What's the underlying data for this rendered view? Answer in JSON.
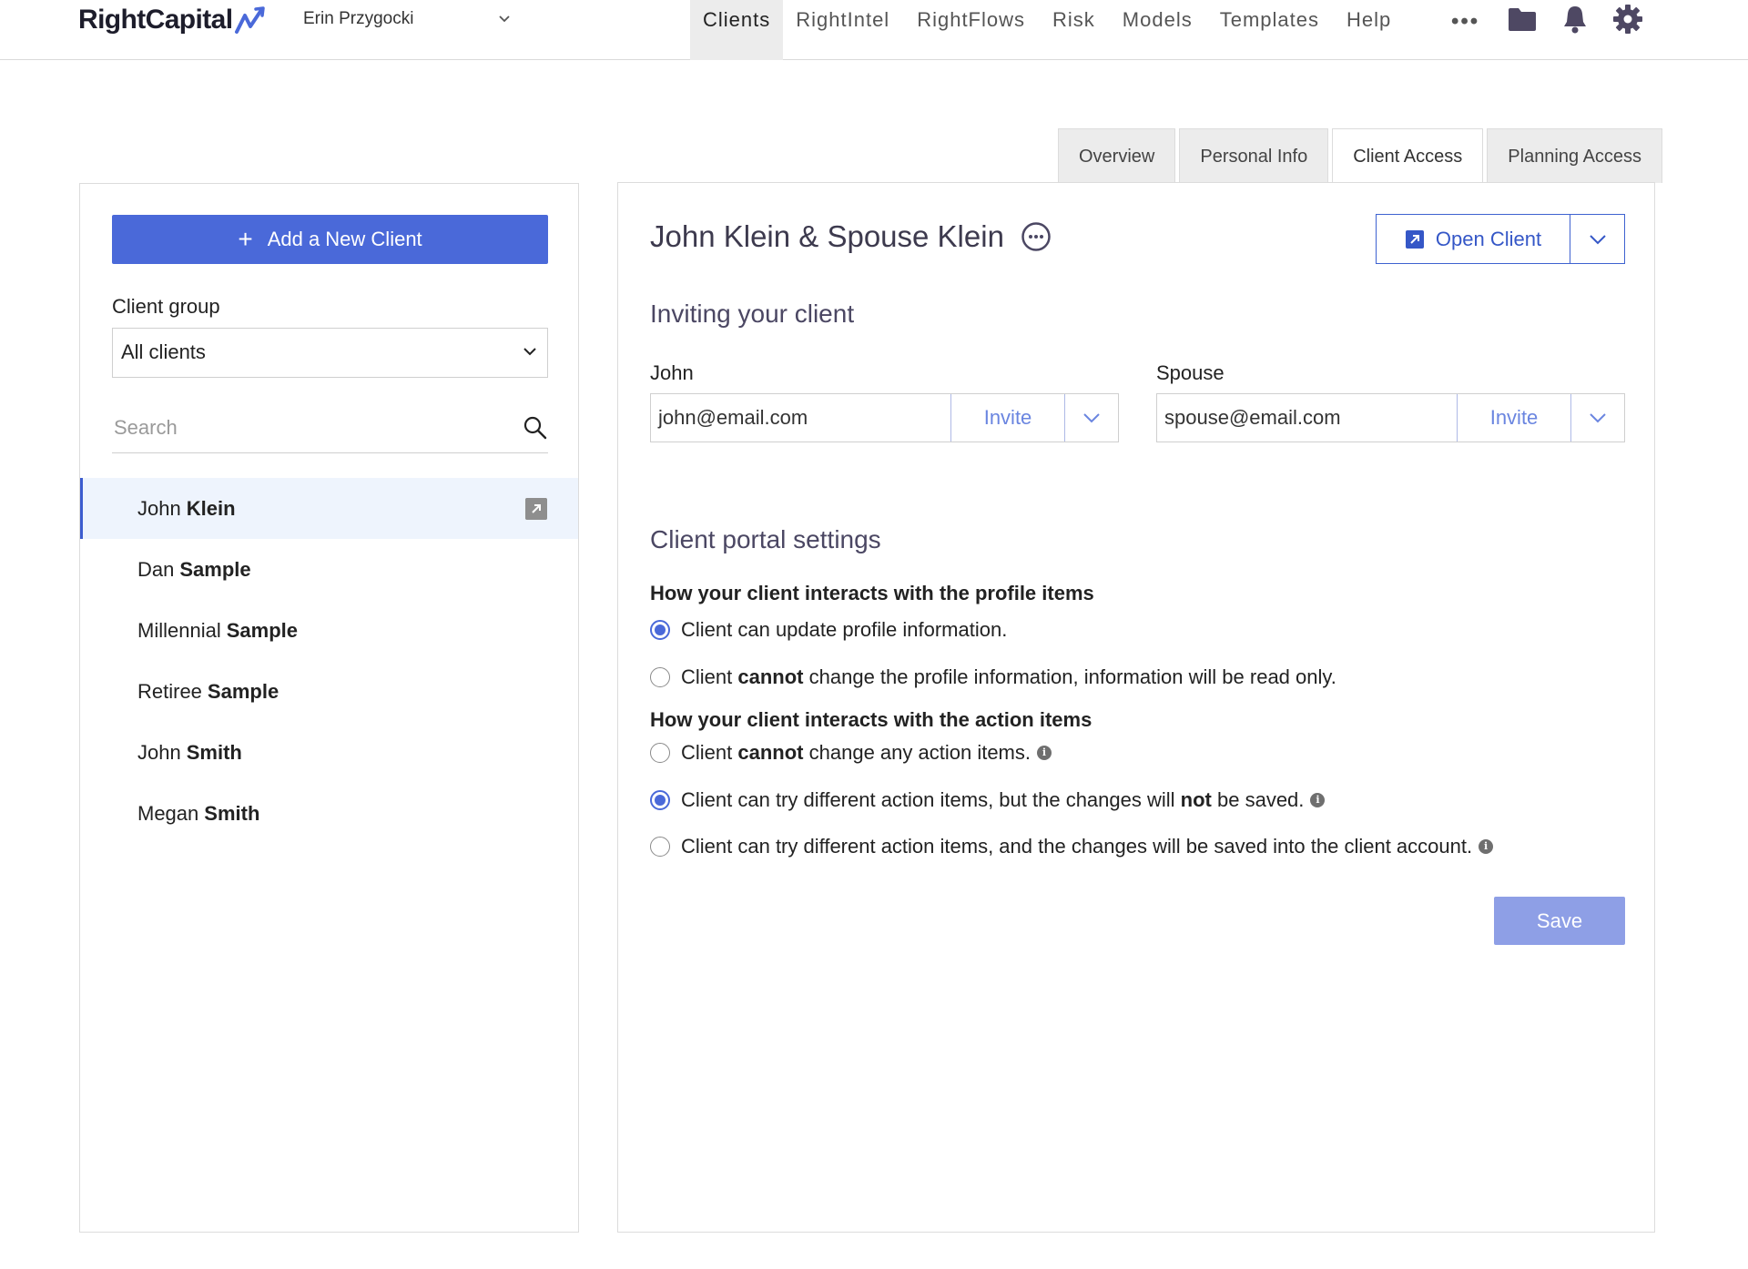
{
  "brand": {
    "name": "RightCapital",
    "accent": "#4a69d9"
  },
  "header": {
    "user_name": "Erin Przygocki",
    "nav": [
      "Clients",
      "RightIntel",
      "RightFlows",
      "Risk",
      "Models",
      "Templates",
      "Help"
    ],
    "active_nav": "Clients",
    "more_label": "•••",
    "icons": [
      "folder-icon",
      "bell-icon",
      "gear-icon"
    ]
  },
  "sidebar": {
    "add_client_label": "Add a New Client",
    "client_group_label": "Client group",
    "client_group_value": "All clients",
    "search_placeholder": "Search",
    "clients": [
      {
        "first": "John",
        "last": "Klein",
        "active": true
      },
      {
        "first": "Dan",
        "last": "Sample"
      },
      {
        "first": "Millennial",
        "last": "Sample"
      },
      {
        "first": "Retiree",
        "last": "Sample"
      },
      {
        "first": "John",
        "last": "Smith"
      },
      {
        "first": "Megan",
        "last": "Smith"
      }
    ]
  },
  "tabs": [
    "Overview",
    "Personal Info",
    "Client Access",
    "Planning Access"
  ],
  "active_tab": "Client Access",
  "main": {
    "title": "John Klein & Spouse Klein",
    "open_client_label": "Open Client",
    "invite_heading": "Inviting your client",
    "john": {
      "label": "John",
      "email": "john@email.com",
      "invite_label": "Invite"
    },
    "spouse": {
      "label": "Spouse",
      "email": "spouse@email.com",
      "invite_label": "Invite"
    },
    "portal_heading": "Client portal settings",
    "profile_heading": "How your client interacts with the profile items",
    "profile_options": {
      "opt1": "Client can update profile information.",
      "opt2_a": "Client",
      "opt2_b": "cannot",
      "opt2_c": "change the profile information, information will be read only.",
      "selected": 0
    },
    "action_heading": "How your client interacts with the action items",
    "action_options": {
      "opt1_a": "Client",
      "opt1_b": "cannot",
      "opt1_c": "change any action items.",
      "opt2_a": "Client can try different action items, but the changes will",
      "opt2_b": "not",
      "opt2_c": "be saved.",
      "opt3": "Client can try different action items, and the changes will be saved into the client account.",
      "selected": 1
    },
    "save_label": "Save",
    "info_glyph": "i"
  }
}
